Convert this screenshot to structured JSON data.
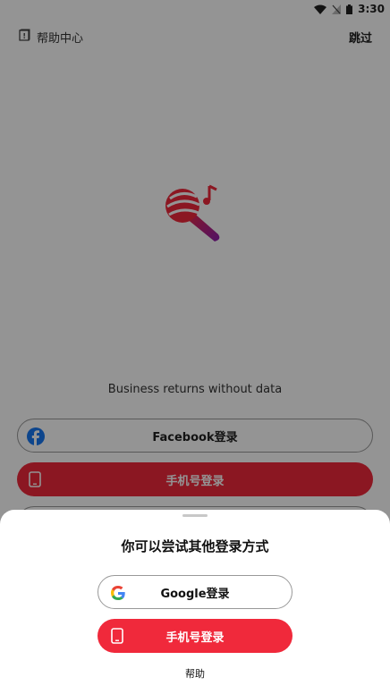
{
  "status_bar": {
    "time": "3:30"
  },
  "header": {
    "help_center_label": "帮助中心",
    "skip_label": "跳过"
  },
  "tagline": "Business returns without data",
  "login_options": {
    "facebook_label": "Facebook登录",
    "phone_label": "手机号登录"
  },
  "sheet": {
    "title": "你可以尝试其他登录方式",
    "google_label": "Google登录",
    "phone_label": "手机号登录",
    "help_label": "帮助"
  },
  "colors": {
    "accent": "#f0293b",
    "facebook_blue": "#1877f2"
  }
}
